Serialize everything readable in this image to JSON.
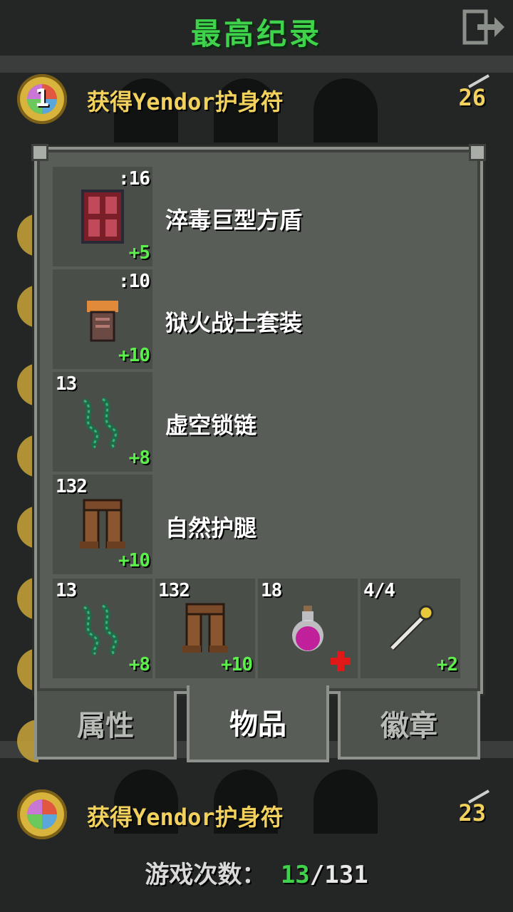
{
  "header": {
    "title": "最高纪录",
    "exit_icon": "exit-icon"
  },
  "records": [
    {
      "rank": "1",
      "text": "获得Yendor护身符",
      "depth": "26"
    },
    {
      "rank": "",
      "text": "获得Yendor护身符",
      "depth": "23"
    }
  ],
  "dialog": {
    "equipped": [
      {
        "top_right": ":16",
        "upgrade": "+5",
        "name": "淬毒巨型方盾",
        "icon": "tower-shield-icon"
      },
      {
        "top_right": ":10",
        "upgrade": "+10",
        "name": "狱火战士套装",
        "icon": "armor-icon"
      },
      {
        "top_left": "13",
        "upgrade": "+8",
        "name": "虚空锁链",
        "icon": "chain-icon"
      },
      {
        "top_left": "132",
        "upgrade": "+10",
        "name": "自然护腿",
        "icon": "leggings-icon"
      }
    ],
    "quickslots": [
      {
        "top_left": "13",
        "bottom_right": "+8",
        "icon": "chain-icon"
      },
      {
        "top_left": "132",
        "bottom_right": "+10",
        "icon": "leggings-icon"
      },
      {
        "top_left": "18",
        "bottom_right": "",
        "icon": "potion-icon",
        "badge_icon": "heal-cross-icon"
      },
      {
        "top_left": "4/4",
        "bottom_right": "+2",
        "icon": "wand-icon"
      }
    ],
    "tabs": [
      {
        "label": "属性",
        "active": false
      },
      {
        "label": "物品",
        "active": true
      },
      {
        "label": "徽章",
        "active": false
      }
    ]
  },
  "footer": {
    "label": "游戏次数：",
    "current": "13",
    "separator": "/",
    "total": "131"
  },
  "colors": {
    "title_green": "#3fd24b",
    "gold_text": "#f2d25c",
    "upgrade_green": "#5df04d",
    "panel": "#595d58"
  }
}
